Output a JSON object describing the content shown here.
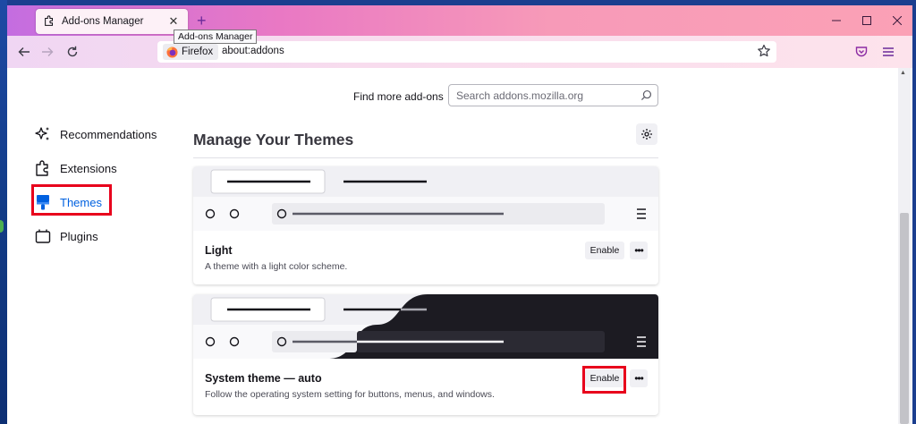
{
  "window": {
    "tab_title": "Add-ons Manager",
    "tooltip": "Add-ons Manager",
    "new_tab_icon": "plus-icon",
    "controls": [
      "minimize-icon",
      "maximize-icon",
      "close-icon"
    ]
  },
  "navbar": {
    "identity_label": "Firefox",
    "url": "about:addons"
  },
  "search": {
    "label": "Find more add-ons",
    "placeholder": "Search addons.mozilla.org"
  },
  "sidebar": {
    "items": [
      {
        "label": "Recommendations",
        "icon": "sparkles-icon",
        "active": false
      },
      {
        "label": "Extensions",
        "icon": "puzzle-icon",
        "active": false
      },
      {
        "label": "Themes",
        "icon": "brush-icon",
        "active": true
      },
      {
        "label": "Plugins",
        "icon": "plugin-icon",
        "active": false
      }
    ]
  },
  "main": {
    "heading": "Manage Your Themes",
    "themes": [
      {
        "name": "Light",
        "description": "A theme with a light color scheme.",
        "enable_label": "Enable",
        "more_label": "•••"
      },
      {
        "name": "System theme — auto",
        "description": "Follow the operating system setting for buttons, menus, and windows.",
        "enable_label": "Enable",
        "more_label": "•••"
      }
    ]
  },
  "colors": {
    "accent": "#0061e0",
    "highlight": "#e8001c",
    "dark_theme": "#1c1b22"
  }
}
